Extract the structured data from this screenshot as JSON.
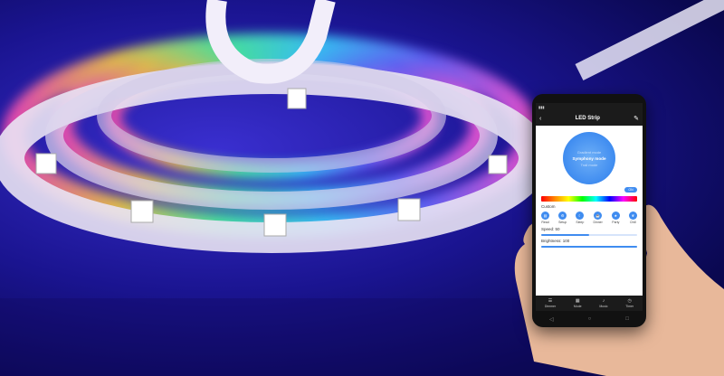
{
  "phone": {
    "status_right": "",
    "app_title": "LED Strip",
    "back_icon": "back-arrow-icon",
    "edit_icon": "edit-icon",
    "modes": [
      {
        "label": "Gradient mode",
        "selected": false
      },
      {
        "label": "Symphony mode",
        "selected": true
      },
      {
        "label": "Trail mode",
        "selected": false
      }
    ],
    "toggle_label": "ON",
    "custom_label": "Custom",
    "scenes": [
      {
        "label": "Read",
        "icon": "book-icon"
      },
      {
        "label": "Setup",
        "icon": "gear-icon"
      },
      {
        "label": "Sleep",
        "icon": "moon-icon"
      },
      {
        "label": "Dinner",
        "icon": "cup-icon"
      },
      {
        "label": "Party",
        "icon": "party-icon"
      },
      {
        "label": "Chill",
        "icon": "leaf-icon"
      }
    ],
    "speed_label": "Speed: 50",
    "speed_value": 0.5,
    "brightness_label": "Brightness: 100",
    "brightness_value": 1.0,
    "tabs": [
      {
        "label": "Dimmer",
        "icon": "sliders-icon"
      },
      {
        "label": "Mode",
        "icon": "grid-icon"
      },
      {
        "label": "Music",
        "icon": "music-icon"
      },
      {
        "label": "Timer",
        "icon": "clock-icon"
      }
    ]
  }
}
